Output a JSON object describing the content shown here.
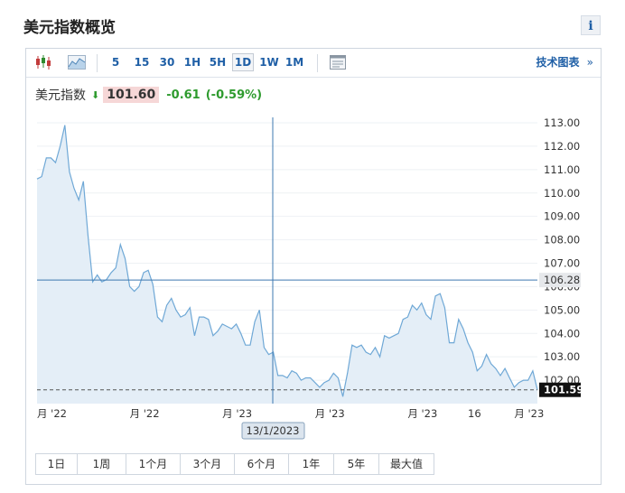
{
  "header": {
    "title": "美元指数概览",
    "info_label": "i"
  },
  "toolbar": {
    "intervals": [
      "5",
      "15",
      "30",
      "1H",
      "5H",
      "1D",
      "1W",
      "1M"
    ],
    "active_interval": "1D",
    "tech_label": "技术图表",
    "tech_arrow": "»",
    "icons": [
      "candlestick-icon",
      "area-chart-icon",
      "layout-icon"
    ]
  },
  "quote": {
    "name": "美元指数",
    "price": "101.60",
    "change": "-0.61",
    "change_pct": "(-0.59%)",
    "direction_color": "#2e9b2e"
  },
  "crosshair": {
    "x_label": "13/1/2023",
    "y_label": "106.28",
    "y_value": 106.28
  },
  "last_price_label": "101.59",
  "ranges": [
    "1日",
    "1周",
    "1个月",
    "3个月",
    "6个月",
    "1年",
    "5年",
    "最大值"
  ],
  "chart_data": {
    "type": "area",
    "ylim": [
      101.0,
      113.0
    ],
    "y_ticks": [
      "113.00",
      "112.00",
      "111.00",
      "110.00",
      "109.00",
      "108.00",
      "107.00",
      "106.00",
      "105.00",
      "104.00",
      "103.00",
      "102.00"
    ],
    "y_tick_values": [
      113,
      112,
      111,
      110,
      109,
      108,
      107,
      106,
      105,
      104,
      103,
      102
    ],
    "x_tick_labels": [
      "月 '22",
      "月 '22",
      "月 '23",
      "月 '23",
      "月 '23",
      "16",
      "月 '23"
    ],
    "x_tick_index": [
      0,
      20,
      40,
      60,
      80,
      93,
      103
    ],
    "last_value": 101.59,
    "line_color": "#6fa8d6",
    "fill_color": "#e4eef7",
    "series": [
      {
        "values": [
          110.6,
          110.7,
          111.5,
          111.5,
          111.3,
          112.0,
          112.9,
          110.9,
          110.2,
          109.7,
          110.5,
          108.2,
          106.2,
          106.5,
          106.2,
          106.3,
          106.6,
          106.8,
          107.8,
          107.2,
          106.0,
          105.8,
          106.0,
          106.6,
          106.7,
          106.1,
          104.7,
          104.5,
          105.2,
          105.5,
          105.0,
          104.7,
          104.8,
          105.1,
          103.9,
          104.7,
          104.7,
          104.6,
          103.9,
          104.1,
          104.4,
          104.3,
          104.2,
          104.4,
          104.0,
          103.5,
          103.5,
          104.5,
          105.0,
          103.4,
          103.1,
          103.2,
          102.2,
          102.2,
          102.1,
          102.4,
          102.3,
          102.0,
          102.1,
          102.1,
          101.9,
          101.7,
          101.9,
          102.0,
          102.3,
          102.1,
          101.3,
          102.3,
          103.5,
          103.4,
          103.5,
          103.2,
          103.1,
          103.4,
          103.0,
          103.9,
          103.8,
          103.9,
          104.0,
          104.6,
          104.7,
          105.2,
          105.0,
          105.3,
          104.8,
          104.6,
          105.6,
          105.7,
          105.1,
          103.6,
          103.6,
          104.6,
          104.2,
          103.6,
          103.2,
          102.4,
          102.6,
          103.1,
          102.7,
          102.5,
          102.2,
          102.5,
          102.1,
          101.7,
          101.9,
          102.0,
          102.0,
          102.4,
          101.59
        ]
      }
    ]
  }
}
